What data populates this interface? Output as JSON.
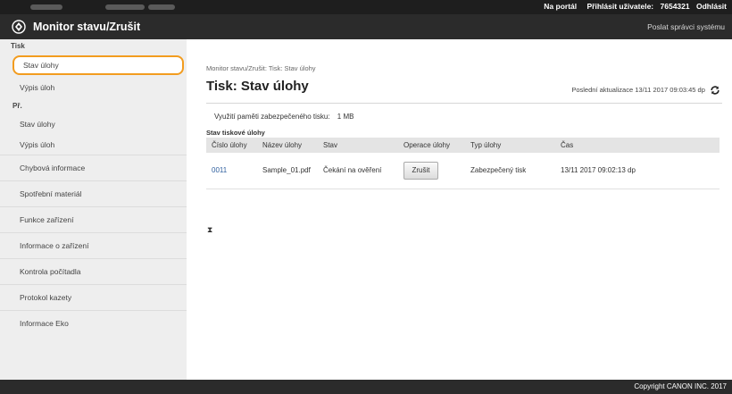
{
  "topbar": {
    "links": [
      "Na portál",
      "Přihlásit uživatele:",
      "7654321",
      "Odhlásit"
    ]
  },
  "header": {
    "title": "Monitor stavu/Zrušit",
    "admin_link": "Poslat správci systému"
  },
  "sidebar": {
    "section_print": "Tisk",
    "print_items": [
      "Stav úlohy",
      "Výpis úloh"
    ],
    "section_rx": "Př.",
    "rx_items": [
      "Stav úlohy",
      "Výpis úloh"
    ],
    "groups": [
      "Chybová informace",
      "Spotřební materiál",
      "Funkce zařízení",
      "Informace o zařízení",
      "Kontrola počítadla",
      "Protokol kazety",
      "Informace Eko"
    ]
  },
  "main": {
    "breadcrumb": "Monitor stavu/Zrušit: Tisk: Stav úlohy",
    "title": "Tisk: Stav úlohy",
    "last_update": "Poslední aktualizace 13/11 2017 09:03:45 dp",
    "memory_label": "Využití paměti zabezpečeného tisku:",
    "memory_value": "1 MB",
    "table_title": "Stav tiskové úlohy",
    "columns": [
      "Číslo úlohy",
      "Název úlohy",
      "Stav",
      "Operace úlohy",
      "Typ úlohy",
      "Čas"
    ],
    "rows": [
      {
        "job_no": "0011",
        "job_name": "Sample_01.pdf",
        "status": "Čekání na ověření",
        "action": "Zrušit",
        "type": "Zabezpečený tisk",
        "time": "13/11 2017 09:02:13 dp"
      }
    ],
    "top_link": "⧗"
  },
  "footer": {
    "copyright": "Copyright CANON INC. 2017"
  },
  "colors": {
    "topbar_bg": "#1e1e1e",
    "header_bg": "#2b2b2b",
    "sidebar_bg": "#eeeeee",
    "active_border": "#f29c1f",
    "link": "#2f5f9e"
  }
}
